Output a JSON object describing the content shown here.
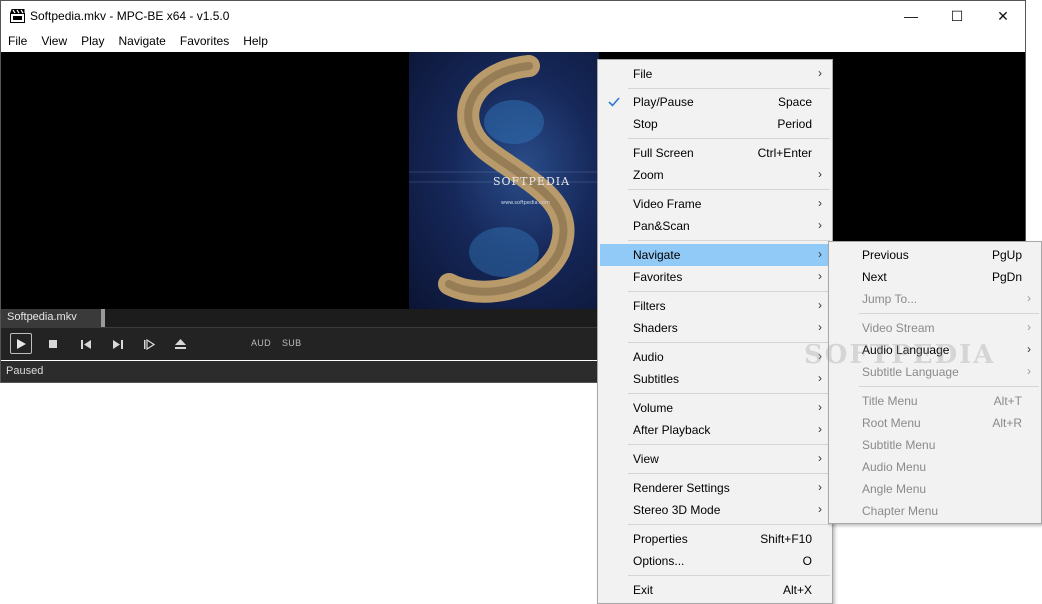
{
  "window": {
    "title": "Softpedia.mkv - MPC-BE x64 - v1.5.0",
    "minimize_glyph": "—",
    "maximize_glyph": "☐",
    "close_glyph": "✕"
  },
  "menubar": [
    "File",
    "View",
    "Play",
    "Navigate",
    "Favorites",
    "Help"
  ],
  "video": {
    "art_text": "SOFTPEDIA",
    "art_url_text": "www.softpedia.com"
  },
  "filebar": {
    "filename": "Softpedia.mkv"
  },
  "controls": {
    "aud_label": "AUD",
    "sub_label": "SUB"
  },
  "status": {
    "text": "Paused"
  },
  "context_menu": {
    "items": [
      {
        "label": "File",
        "shortcut": "",
        "submenu": true
      },
      {
        "label": "Play/Pause",
        "shortcut": "Space",
        "checked": true
      },
      {
        "label": "Stop",
        "shortcut": "Period"
      },
      {
        "label": "Full Screen",
        "shortcut": "Ctrl+Enter"
      },
      {
        "label": "Zoom",
        "shortcut": "",
        "submenu": true
      },
      {
        "label": "Video Frame",
        "shortcut": "",
        "submenu": true
      },
      {
        "label": "Pan&Scan",
        "shortcut": "",
        "submenu": true
      },
      {
        "label": "Navigate",
        "shortcut": "",
        "submenu": true,
        "highlighted": true
      },
      {
        "label": "Favorites",
        "shortcut": "",
        "submenu": true
      },
      {
        "label": "Filters",
        "shortcut": "",
        "submenu": true
      },
      {
        "label": "Shaders",
        "shortcut": "",
        "submenu": true
      },
      {
        "label": "Audio",
        "shortcut": "",
        "submenu": true
      },
      {
        "label": "Subtitles",
        "shortcut": "",
        "submenu": true
      },
      {
        "label": "Volume",
        "shortcut": "",
        "submenu": true
      },
      {
        "label": "After Playback",
        "shortcut": "",
        "submenu": true
      },
      {
        "label": "View",
        "shortcut": "",
        "submenu": true
      },
      {
        "label": "Renderer Settings",
        "shortcut": "",
        "submenu": true
      },
      {
        "label": "Stereo 3D Mode",
        "shortcut": "",
        "submenu": true
      },
      {
        "label": "Properties",
        "shortcut": "Shift+F10"
      },
      {
        "label": "Options...",
        "shortcut": "O"
      },
      {
        "label": "Exit",
        "shortcut": "Alt+X"
      }
    ]
  },
  "navigate_submenu": {
    "items": [
      {
        "label": "Previous",
        "shortcut": "PgUp"
      },
      {
        "label": "Next",
        "shortcut": "PgDn"
      },
      {
        "label": "Jump To...",
        "shortcut": "",
        "submenu": true,
        "disabled": true
      },
      {
        "label": "Video Stream",
        "shortcut": "",
        "submenu": true,
        "disabled": true
      },
      {
        "label": "Audio Language",
        "shortcut": "",
        "submenu": true
      },
      {
        "label": "Subtitle Language",
        "shortcut": "",
        "submenu": true,
        "disabled": true
      },
      {
        "label": "Title Menu",
        "shortcut": "Alt+T",
        "disabled": true
      },
      {
        "label": "Root Menu",
        "shortcut": "Alt+R",
        "disabled": true
      },
      {
        "label": "Subtitle Menu",
        "shortcut": "",
        "disabled": true
      },
      {
        "label": "Audio Menu",
        "shortcut": "",
        "disabled": true
      },
      {
        "label": "Angle Menu",
        "shortcut": "",
        "disabled": true
      },
      {
        "label": "Chapter Menu",
        "shortcut": "",
        "disabled": true
      }
    ]
  },
  "watermark": "SOFTPEDIA",
  "colors": {
    "highlight": "#91c9f7",
    "menu_bg": "#f2f2f2",
    "video_bg": "#000000",
    "controls_bg": "#232323",
    "check_color": "#2b7bd3"
  },
  "arrow_glyph": "›"
}
